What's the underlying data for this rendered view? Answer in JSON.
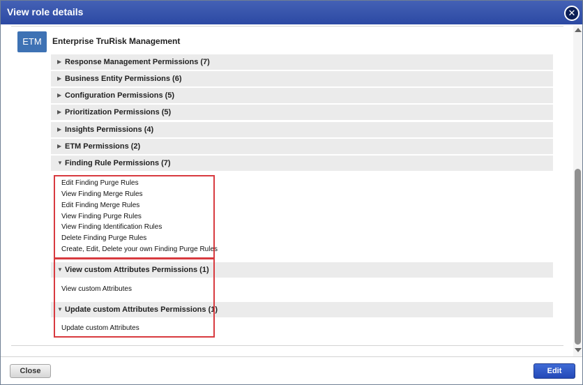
{
  "dialog": {
    "title": "View role details",
    "close_glyph": "✕"
  },
  "module": {
    "badge": "ETM",
    "name": "Enterprise TruRisk Management"
  },
  "groups": [
    {
      "label": "Response Management Permissions (7)",
      "arrow": "▶"
    },
    {
      "label": "Business Entity Permissions (6)",
      "arrow": "▶"
    },
    {
      "label": "Configuration Permissions (5)",
      "arrow": "▶"
    },
    {
      "label": "Prioritization Permissions (5)",
      "arrow": "▶"
    },
    {
      "label": "Insights Permissions (4)",
      "arrow": "▶"
    },
    {
      "label": "ETM Permissions (2)",
      "arrow": "▶"
    },
    {
      "label": "Finding Rule Permissions (7)",
      "arrow": "▼"
    },
    {
      "label": "View custom Attributes Permissions (1)",
      "arrow": "▼"
    },
    {
      "label": "Update custom Attributes Permissions (1)",
      "arrow": "▼"
    }
  ],
  "finding_rule_items": [
    "Edit Finding Purge Rules",
    "View Finding Merge Rules",
    "Edit Finding Merge Rules",
    "View Finding Purge Rules",
    "View Finding Identification Rules",
    "Delete Finding Purge Rules",
    "Create, Edit, Delete your own Finding Purge Rules"
  ],
  "view_custom_items": [
    "View custom Attributes"
  ],
  "update_custom_items": [
    "Update custom Attributes"
  ],
  "footer": {
    "close_label": "Close",
    "edit_label": "Edit"
  },
  "colors": {
    "titlebar": "#2f4ea6",
    "badge": "#3e72b4",
    "highlight": "#d83a3f",
    "primary_button": "#2d55c4"
  }
}
